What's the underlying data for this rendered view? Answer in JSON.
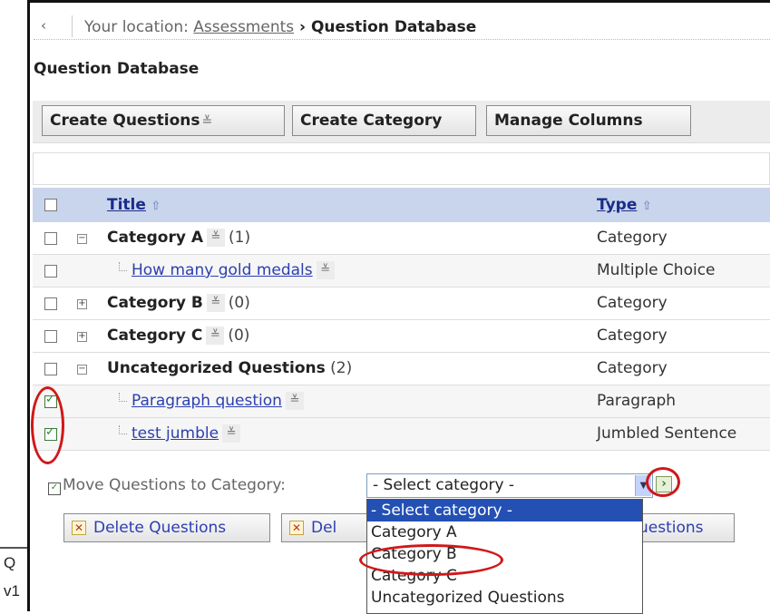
{
  "external": {
    "line1": "Q",
    "line2": "v1"
  },
  "breadcrumb": {
    "back_label": "‹",
    "prefix": "Your location: ",
    "link": "Assessments",
    "separator": " › ",
    "current": "Question Database"
  },
  "page": {
    "title": "Question Database"
  },
  "toolbar": {
    "create_questions": "Create Questions",
    "create_category": "Create Category",
    "manage_columns": "Manage Columns"
  },
  "table": {
    "header": {
      "title": "Title",
      "type": "Type",
      "sort_icon": "⇧"
    },
    "rows": [
      {
        "name": "Category A",
        "count": "(1)",
        "type": "Category"
      },
      {
        "name": "How many gold medals",
        "type": "Multiple Choice"
      },
      {
        "name": "Category B",
        "count": "(0)",
        "type": "Category"
      },
      {
        "name": "Category C",
        "count": "(0)",
        "type": "Category"
      },
      {
        "name": "Uncategorized Questions",
        "count": "(2)",
        "type": "Category"
      },
      {
        "name": "Paragraph question",
        "type": "Paragraph",
        "checked": true
      },
      {
        "name": "test jumble",
        "type": "Jumbled Sentence",
        "checked": true
      }
    ]
  },
  "move": {
    "label": "Move Questions to Category:",
    "selected": "- Select category -",
    "go_label": "›"
  },
  "actions": {
    "delete_questions": "Delete Questions",
    "delete_partial": "Del",
    "questions_partial": "uestions"
  },
  "dropdown": {
    "options": [
      "- Select category -",
      "Category A",
      "Category B",
      "Category C",
      "Uncategorized Questions"
    ]
  },
  "icons": {
    "menu": "context-menu-icon",
    "sort": "sort-ascending-icon",
    "expand": "tree-expand-icon",
    "collapse": "tree-collapse-icon",
    "delete": "delete-icon",
    "go": "go-arrow-icon",
    "move": "move-checkbox-icon"
  },
  "colors": {
    "annotation": "#d01818",
    "header_bg": "#c9d5ec",
    "link": "#2b3fb0",
    "selected_option": "#2450b4"
  }
}
